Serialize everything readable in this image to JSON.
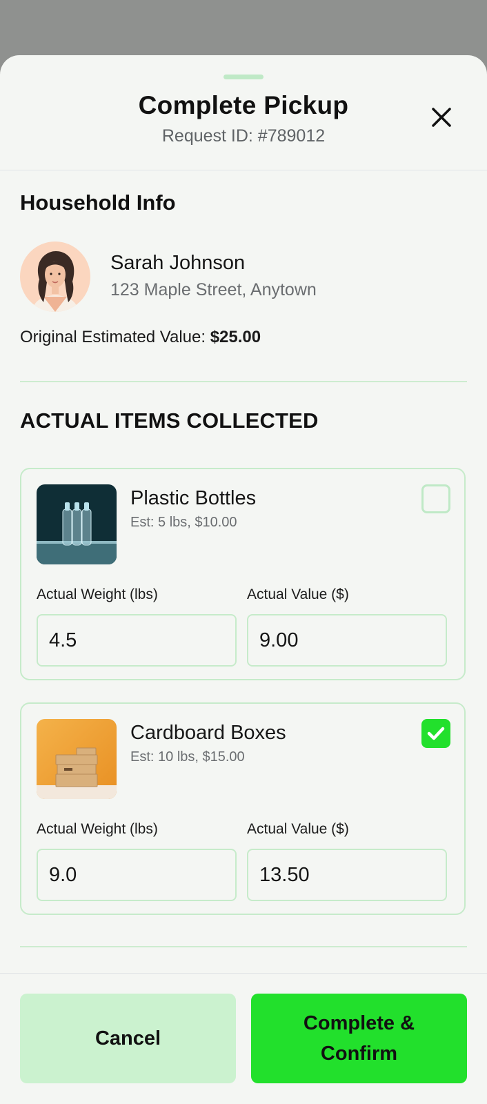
{
  "header": {
    "title": "Complete Pickup",
    "request_id": "Request ID: #789012",
    "close_icon": "close-icon"
  },
  "household": {
    "section_title": "Household Info",
    "name": "Sarah Johnson",
    "address": "123 Maple Street, Anytown",
    "estimate_label": "Original Estimated Value:",
    "estimate_value": "$25.00"
  },
  "items_section": {
    "title": "ACTUAL ITEMS COLLECTED",
    "weight_label": "Actual Weight (lbs)",
    "value_label": "Actual Value ($)",
    "items": [
      {
        "name": "Plastic Bottles",
        "estimate": "Est: 5 lbs, $10.00",
        "checked": false,
        "actual_weight": "4.5",
        "actual_value": "9.00"
      },
      {
        "name": "Cardboard Boxes",
        "estimate": "Est: 10 lbs, $15.00",
        "checked": true,
        "actual_weight": "9.0",
        "actual_value": "13.50"
      }
    ]
  },
  "footer": {
    "cancel_label": "Cancel",
    "confirm_label": "Complete & Confirm"
  },
  "colors": {
    "accent": "#22e02c",
    "accent_light": "#cbf2cf",
    "border": "#c6ebca",
    "background": "#f4f6f3"
  }
}
